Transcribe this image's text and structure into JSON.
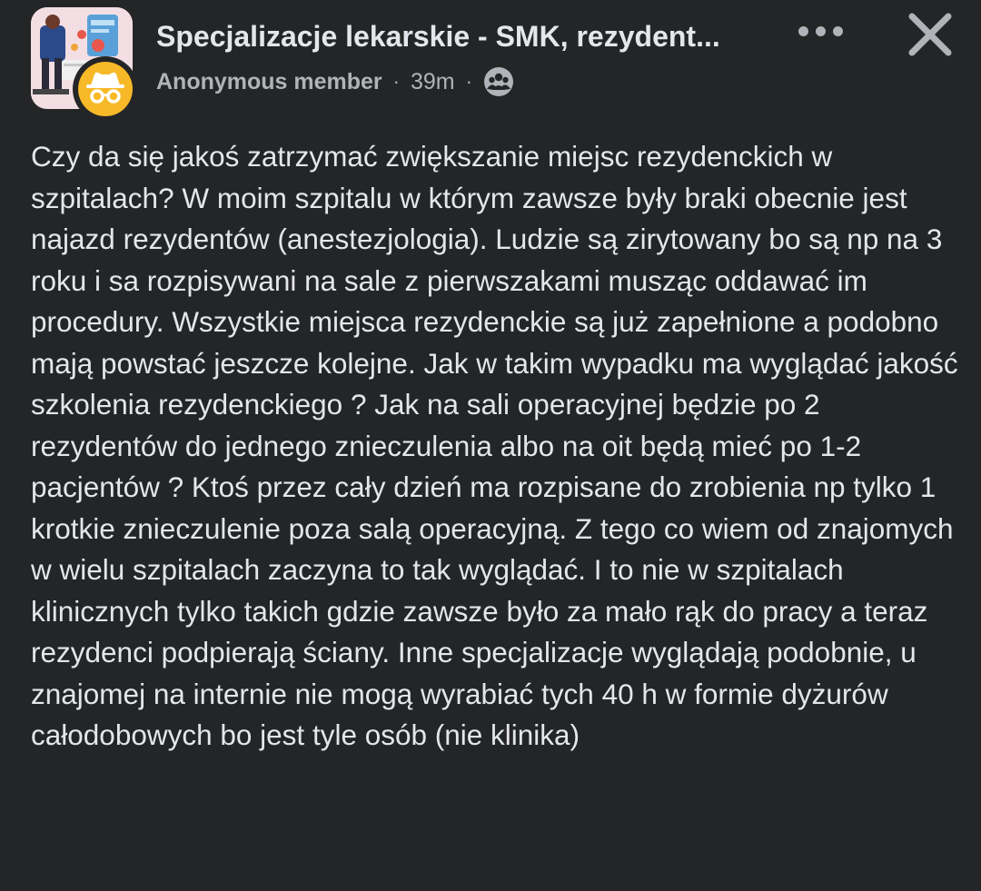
{
  "header": {
    "group_name": "Specjalizacje lekarskie - SMK, rezydent...",
    "author": "Anonymous member",
    "separator": "·",
    "timestamp": "39m",
    "privacy_icon": "group-members-icon",
    "more_icon": "more-horizontal-icon",
    "close_icon": "close-icon"
  },
  "post": {
    "text": "Czy da się jakoś zatrzymać zwiększanie miejsc rezydenckich w szpitalach? W moim szpitalu w którym zawsze były braki obecnie jest najazd rezydentów (anestezjologia). Ludzie są zirytowany bo są np na 3 roku i sa rozpisywani na sale z pierwszakami musząc oddawać im procedury. Wszystkie miejsca rezydenckie są już zapełnione a podobno mają powstać jeszcze kolejne. Jak w takim wypadku ma wyglądać jakość szkolenia rezydenckiego ? Jak na sali operacyjnej będzie po 2 rezydentów do jednego znieczulenia albo na oit będą mieć po 1-2 pacjentów ? Ktoś przez cały dzień ma rozpisane do zrobienia np tylko 1 krotkie znieczulenie poza salą operacyjną. Z tego co wiem od znajomych w wielu szpitalach zaczyna to tak wyglądać. I to nie w szpitalach klinicznych tylko takich gdzie zawsze było za mało rąk do pracy a teraz rezydenci podpierają ściany. Inne specjalizacje wyglądają podobnie, u znajomej na internie nie mogą wyrabiać tych 40 h w formie dyżurów całodobowych bo jest tyle osób (nie klinika)"
  },
  "colors": {
    "background": "#242526",
    "text_primary": "#e4e6eb",
    "text_secondary": "#b0b3b8",
    "anon_badge": "#f7b928"
  }
}
